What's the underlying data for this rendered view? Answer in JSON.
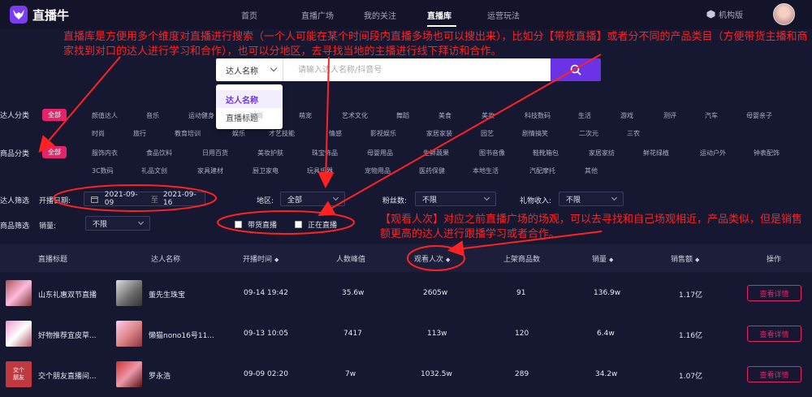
{
  "app": {
    "name": "直播牛"
  },
  "nav": {
    "items": [
      {
        "label": "首页"
      },
      {
        "label": "直播广场"
      },
      {
        "label": "我的关注"
      },
      {
        "label": "直播库"
      },
      {
        "label": "运营玩法"
      }
    ],
    "active_index": 3,
    "org_label": "机构版"
  },
  "annotations": {
    "top": "直播库是方便用多个维度对直播进行搜索（一个人可能在某个时间段内直播多场也可以搜出来），比如分【带货直播】或者分不同的产品类目（方便带货主播和商家找到对口的达人进行学习和合作），也可以分地区，去寻找当地的主播进行线下拜访和合作。",
    "right": "【观看人次】对应之前直播广场的场观，可以去寻找和自己场观相近，产品类似，但是销售额更高的达人进行跟播学习或者合作。",
    "color": "#ff2222"
  },
  "search": {
    "type_selected": "达人名称",
    "placeholder": "请输入达人名称/抖音号",
    "dropdown_options": [
      "达人名称",
      "直播标题"
    ]
  },
  "filters": {
    "talent_category_label": "达人分类",
    "talent_categories_row1": [
      "全部",
      "颜值达人",
      "音乐",
      "运动健身",
      "时尚",
      "萌宠",
      "艺术文化",
      "舞蹈",
      "美食",
      "美妆",
      "科技数码",
      "生活",
      "游戏",
      "测评",
      "汽车",
      "母婴亲子"
    ],
    "talent_categories_row2": [
      "时尚",
      "旅行",
      "教育培训",
      "娱乐",
      "才艺技能",
      "情感",
      "影视娱乐",
      "家居家装",
      "园艺",
      "剧情搞笑",
      "二次元",
      "三农"
    ],
    "product_category_label": "商品分类",
    "product_categories_row1": [
      "全部",
      "服饰内衣",
      "食品饮料",
      "日用百货",
      "美妆护肤",
      "珠宝饰品",
      "母婴用品",
      "生鲜蔬果",
      "图书音像",
      "鞋靴箱包",
      "家居家纺",
      "鲜花绿植",
      "运动户外",
      "钟表配饰"
    ],
    "product_categories_row2": [
      "3C数码",
      "礼品文创",
      "家具建材",
      "厨卫家电",
      "玩具乐器",
      "宠物用品",
      "医药保健",
      "本地生活",
      "汽配摩托",
      "其他"
    ],
    "talent_filter_label": "达人筛选",
    "date_label": "开播日期:",
    "date_start": "2021-09-09",
    "date_sep": "至",
    "date_end": "2021-09-16",
    "region_label": "地区:",
    "region_value": "全部",
    "fans_label": "粉丝数:",
    "fans_value": "不限",
    "gift_label": "礼物收入:",
    "gift_value": "不限",
    "product_filter_label": "商品筛选",
    "sales_label": "销量:",
    "sales_value": "不限",
    "checkbox_goods": "带货直播",
    "checkbox_live": "正在直播"
  },
  "table": {
    "headers": [
      "直播标题",
      "达人名称",
      "开播时间",
      "人数峰值",
      "观看人次",
      "上架商品数",
      "销量",
      "销售额",
      "操作"
    ],
    "rows": [
      {
        "title": "山东礼惠双节直播",
        "talent": "董先生珠宝",
        "start": "09-14 19:42",
        "peak": "35.6w",
        "views": "2605w",
        "items": "91",
        "sales": "136.9w",
        "revenue": "1.17亿",
        "action": "查看详情"
      },
      {
        "title": "好物推荐宜皮草...",
        "talent": "懒猫nono16号11...",
        "start": "09-13 10:05",
        "peak": "7417",
        "views": "113w",
        "items": "120",
        "sales": "6.4w",
        "revenue": "1.16亿",
        "action": "查看详情"
      },
      {
        "title": "交个朋友直播间...",
        "talent": "罗永浩",
        "start": "09-09 02:20",
        "peak": "7w",
        "views": "1032.5w",
        "items": "289",
        "sales": "34.2w",
        "revenue": "1.07亿",
        "action": "查看详情"
      }
    ],
    "third_row_thumb_text": "交个\n朋友"
  },
  "colors": {
    "accent": "#6b33e6",
    "pink": "#e5236a",
    "bg": "#161831"
  }
}
